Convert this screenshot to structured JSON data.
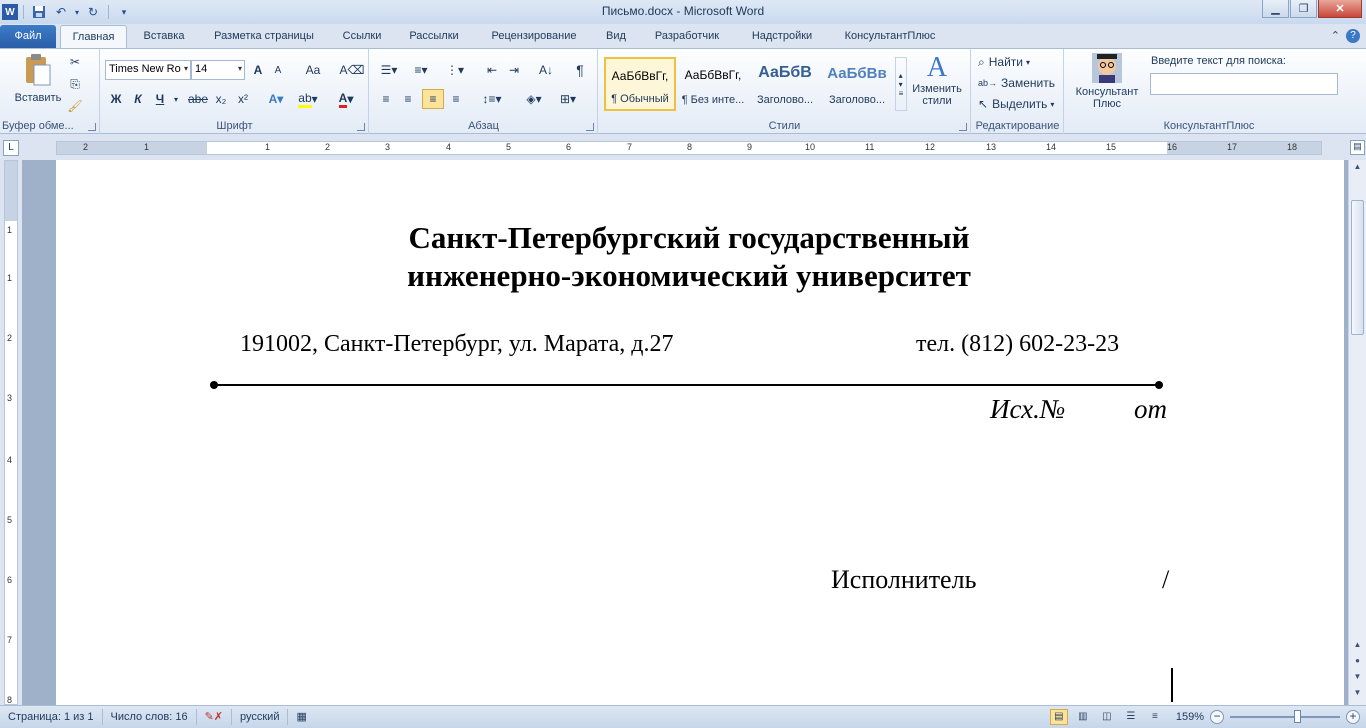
{
  "window": {
    "title": "Письмо.docx - Microsoft Word"
  },
  "qat": {
    "icons": [
      "word-icon",
      "save-icon",
      "undo-icon",
      "redo-icon",
      "customize-icon"
    ]
  },
  "tabs": [
    {
      "label": "Файл"
    },
    {
      "label": "Главная"
    },
    {
      "label": "Вставка"
    },
    {
      "label": "Разметка страницы"
    },
    {
      "label": "Ссылки"
    },
    {
      "label": "Рассылки"
    },
    {
      "label": "Рецензирование"
    },
    {
      "label": "Вид"
    },
    {
      "label": "Разработчик"
    },
    {
      "label": "Надстройки"
    },
    {
      "label": "КонсультантПлюс"
    }
  ],
  "ribbon": {
    "clipboard": {
      "paste_label": "Вставить",
      "group_label": "Буфер обме..."
    },
    "font": {
      "name": "Times New Ro",
      "size": "14",
      "group_label": "Шрифт",
      "bold": "Ж",
      "italic": "К",
      "underline": "Ч",
      "strike": "abe",
      "sub": "x₂",
      "sup": "x²",
      "grow": "A",
      "shrink": "A",
      "case": "Aa"
    },
    "paragraph": {
      "group_label": "Абзац"
    },
    "styles": {
      "group_label": "Стили",
      "tiles": [
        {
          "sample": "АаБбВвГг,",
          "name": "¶ Обычный"
        },
        {
          "sample": "АаБбВвГг,",
          "name": "¶ Без инте..."
        },
        {
          "sample": "АаБбВ",
          "name": "Заголово..."
        },
        {
          "sample": "АаБбВв",
          "name": "Заголово..."
        }
      ],
      "change_label": "Изменить стили"
    },
    "editing": {
      "group_label": "Редактирование",
      "find": "Найти",
      "replace": "Заменить",
      "select": "Выделить"
    },
    "consultant": {
      "button_label": "Консультант Плюс",
      "search_label": "Введите текст для поиска:",
      "group_label": "КонсультантПлюс"
    }
  },
  "ruler": {
    "h_numbers": [
      "2",
      "1",
      "1",
      "2",
      "3",
      "4",
      "5",
      "6",
      "7",
      "8",
      "9",
      "10",
      "11",
      "12",
      "13",
      "14",
      "15",
      "16",
      "17",
      "18"
    ],
    "v_numbers": [
      "1",
      "1",
      "2",
      "3",
      "4",
      "5",
      "6",
      "7",
      "8"
    ]
  },
  "document": {
    "title_line1": "Санкт-Петербургский государственный",
    "title_line2": "инженерно-экономический университет",
    "address": "191002, Санкт-Петербург, ул. Марата, д.27",
    "phone": "тел. (812) 602-23-23",
    "outgoing_no": "Исх.№",
    "outgoing_from": "от",
    "executor": "Исполнитель",
    "slash": "/"
  },
  "status": {
    "page": "Страница: 1 из 1",
    "words": "Число слов: 16",
    "language": "русский",
    "zoom": "159%",
    "zoom_level": 0.62
  }
}
